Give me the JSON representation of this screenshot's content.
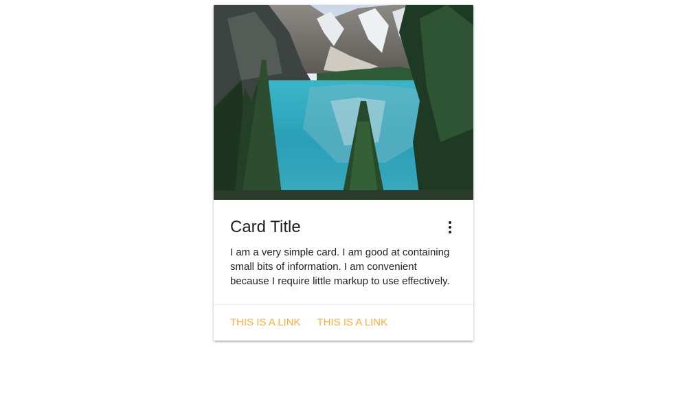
{
  "card": {
    "title": "Card Title",
    "text": "I am a very simple card. I am good at containing small bits of information. I am convenient because I require little markup to use effectively.",
    "menu_icon": "more-vert-icon",
    "links": [
      {
        "label": "THIS IS A LINK"
      },
      {
        "label": "THIS IS A LINK"
      }
    ],
    "image_subject": "mountain-lake-landscape"
  },
  "colors": {
    "link": "#ffab40",
    "text": "#212121",
    "lake": "#2fa3b8"
  }
}
